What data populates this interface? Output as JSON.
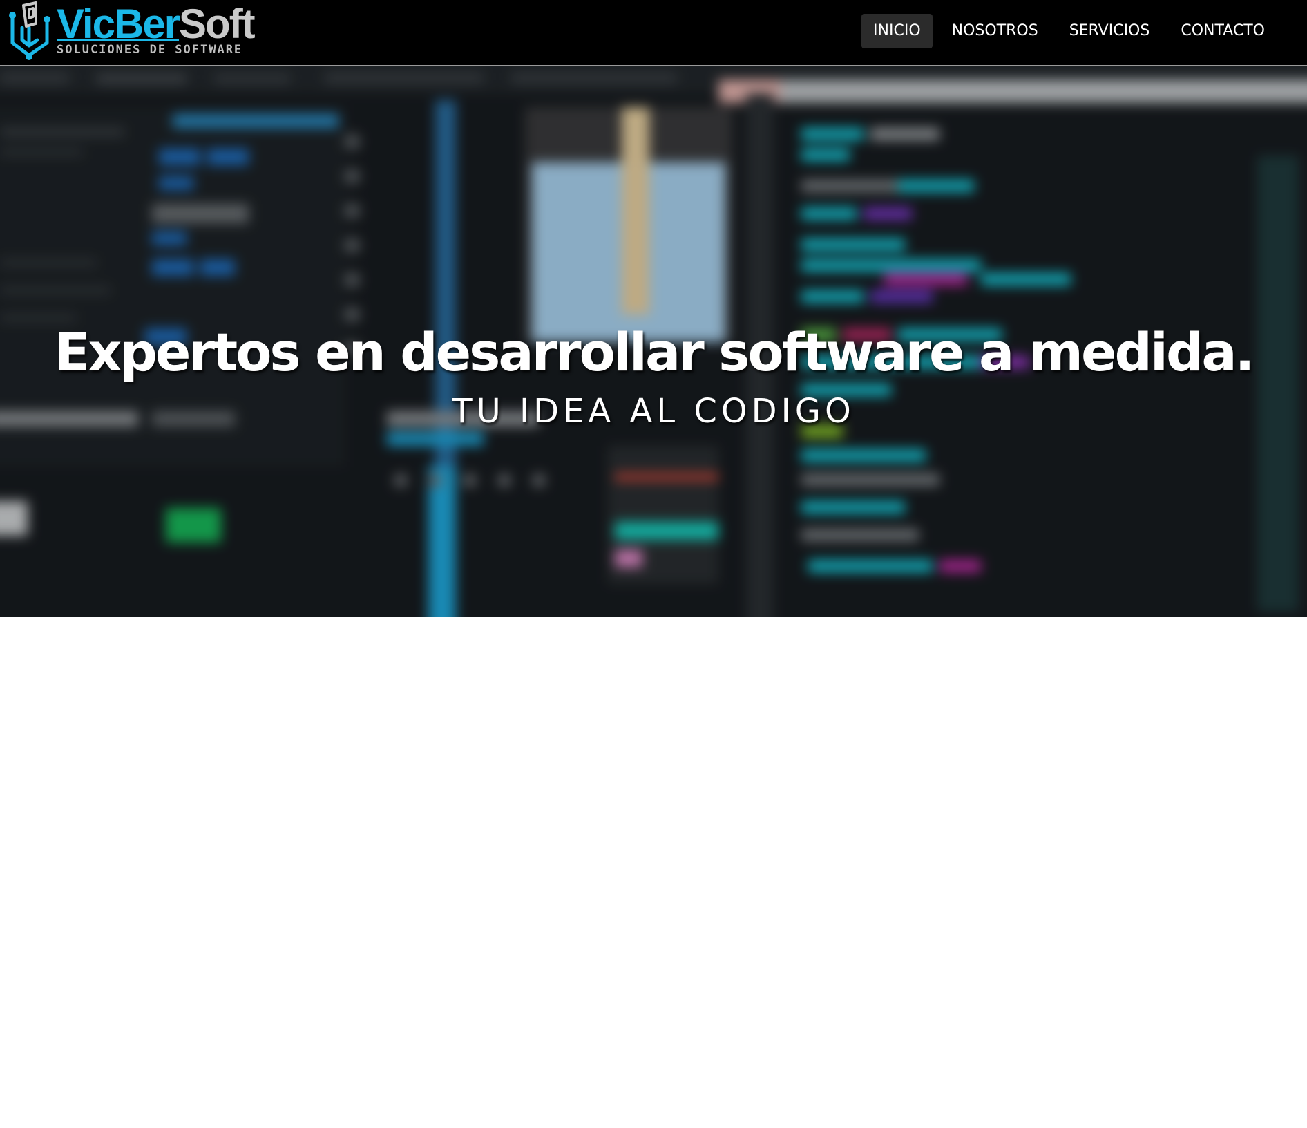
{
  "brand": {
    "name_part1": "VicBer",
    "name_part2": "Soft",
    "tagline": "SOLUCIONES DE SOFTWARE",
    "icon": "circuit-logo-icon",
    "colors": {
      "accent": "#1bb8e8",
      "secondary": "#c9c9c9"
    }
  },
  "nav": {
    "items": [
      {
        "label": "INICIO",
        "active": true
      },
      {
        "label": "NOSOTROS",
        "active": false
      },
      {
        "label": "SERVICIOS",
        "active": false
      },
      {
        "label": "CONTACTO",
        "active": false
      }
    ]
  },
  "hero": {
    "title": "Expertos en desarrollar software a medida.",
    "subtitle": "TU IDEA AL CODIGO"
  },
  "colors": {
    "navbar_bg": "#000000",
    "nav_active_bg": "#2b2b2b",
    "page_bg": "#ffffff"
  }
}
